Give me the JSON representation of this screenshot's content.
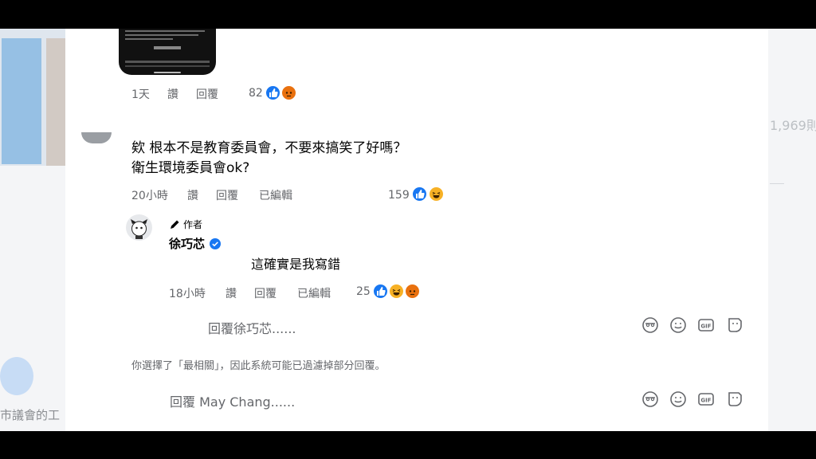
{
  "background": {
    "left_text": "市議會的工",
    "right_number": "1,969",
    "right_suffix": "則"
  },
  "comment_prev": {
    "time": "1天",
    "like_label": "讚",
    "reply_label": "回覆",
    "reaction_count": "82",
    "reactions": [
      "like-icon",
      "angry-icon"
    ]
  },
  "comment_main": {
    "line1": "欸 根本不是教育委員會，不要來搞笑了好嗎？",
    "line2": "衛生環境委員會ok?",
    "time": "20小時",
    "like_label": "讚",
    "reply_label": "回覆",
    "edited_label": "已編輯",
    "reaction_count": "159",
    "reactions": [
      "like-icon",
      "haha-icon"
    ]
  },
  "reply": {
    "author_tag": "作者",
    "author_name": "徐巧芯",
    "text": "這確實是我寫錯",
    "time": "18小時",
    "like_label": "讚",
    "reply_label": "回覆",
    "edited_label": "已編輯",
    "reaction_count": "25",
    "reactions": [
      "like-icon",
      "haha-icon",
      "angry-icon"
    ]
  },
  "reply_input": {
    "placeholder": "回覆徐巧芯......"
  },
  "filter_notice": "你選擇了「最相關」，因此系統可能已過濾掉部分回覆。",
  "bottom_input": {
    "placeholder": "回覆 May Chang......"
  },
  "colors": {
    "like": "#1877f2",
    "haha": "#f7b125",
    "angry": "#e9710f",
    "meta": "#65676b"
  }
}
